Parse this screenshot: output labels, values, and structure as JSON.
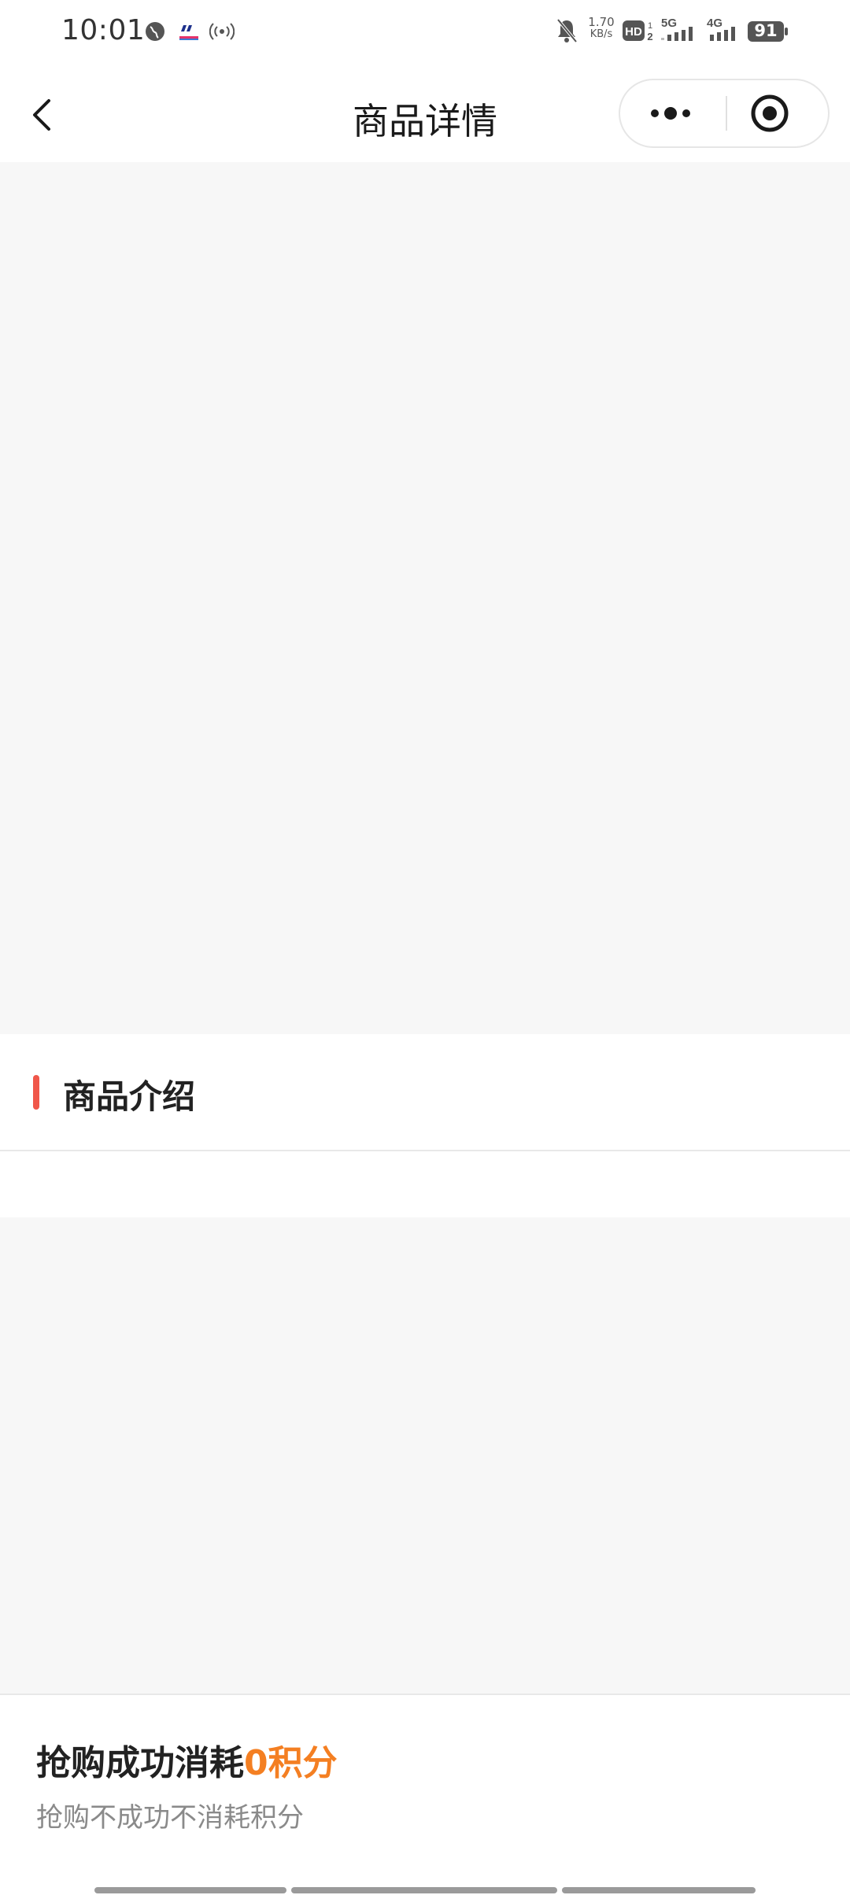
{
  "status_bar": {
    "time": "10:01",
    "net_speed_value": "1.70",
    "net_speed_unit": "KB/s",
    "signal_1": "5G",
    "signal_2": "4G",
    "battery": "91",
    "icons": [
      "globe-icon",
      "app-notification-icon",
      "hotspot-icon",
      "mute-icon",
      "hd-icon",
      "signal-5g-icon",
      "signal-4g-icon",
      "battery-icon"
    ]
  },
  "nav": {
    "title": "商品详情",
    "icons": [
      "back-icon",
      "more-icon",
      "close-miniprogram-icon"
    ]
  },
  "section": {
    "title": "商品介绍"
  },
  "bottom": {
    "cost_prefix": "抢购成功消耗",
    "cost_value": "0积分",
    "note": "抢购不成功不消耗积分"
  },
  "colors": {
    "accent": "#f0574a",
    "highlight": "#f47f22",
    "placeholder_bg": "#f7f7f7"
  }
}
